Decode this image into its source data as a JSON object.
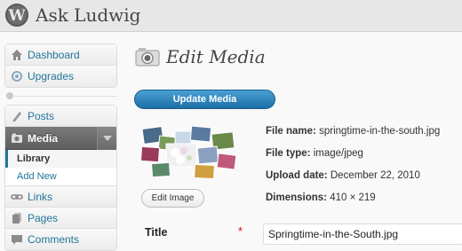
{
  "site": {
    "logo_glyph": "W",
    "title": "Ask Ludwig"
  },
  "sidebar": {
    "group1": [
      {
        "label": "Dashboard",
        "icon": "dashboard-icon"
      },
      {
        "label": "Upgrades",
        "icon": "upgrades-icon"
      }
    ],
    "group2": [
      {
        "label": "Posts",
        "icon": "posts-icon"
      }
    ],
    "media": {
      "label": "Media",
      "icon": "media-icon",
      "submenu": [
        "Library",
        "Add New"
      ]
    },
    "group3": [
      {
        "label": "Links",
        "icon": "links-icon"
      },
      {
        "label": "Pages",
        "icon": "pages-icon"
      },
      {
        "label": "Comments",
        "icon": "comments-icon"
      }
    ]
  },
  "main": {
    "title": "Edit Media",
    "update_button": "Update Media",
    "edit_image_button": "Edit Image",
    "meta": [
      {
        "label": "File name:",
        "value": "springtime-in-the-south.jpg"
      },
      {
        "label": "File type:",
        "value": "image/jpeg"
      },
      {
        "label": "Upload date:",
        "value": "December 22, 2010"
      },
      {
        "label": "Dimensions:",
        "value": "410 × 219"
      }
    ],
    "title_field": {
      "label": "Title",
      "required_mark": "*",
      "value": "Springtime-in-the-South.jpg"
    }
  },
  "colors": {
    "link": "#21759b",
    "primary_button": "#2a84c0",
    "required": "#e00000"
  }
}
